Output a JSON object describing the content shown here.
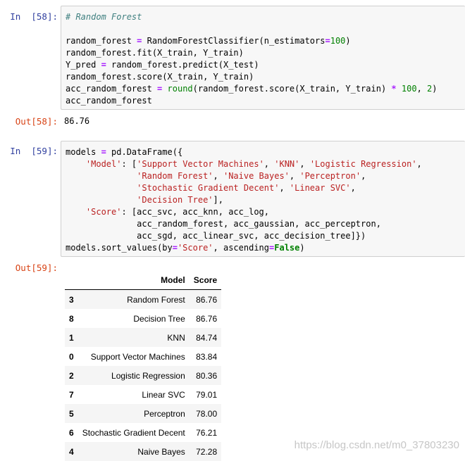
{
  "cells": [
    {
      "in_prompt": "In  [58]:",
      "code_lines": [
        "# Random Forest",
        "",
        "random_forest = RandomForestClassifier(n_estimators=100)",
        "random_forest.fit(X_train, Y_train)",
        "Y_pred = random_forest.predict(X_test)",
        "random_forest.score(X_train, Y_train)",
        "acc_random_forest = round(random_forest.score(X_train, Y_train) * 100, 2)",
        "acc_random_forest"
      ],
      "out_prompt": "Out[58]:",
      "output": "86.76"
    },
    {
      "in_prompt": "In  [59]:",
      "code_lines": [
        "models = pd.DataFrame({",
        "    'Model': ['Support Vector Machines', 'KNN', 'Logistic Regression',",
        "              'Random Forest', 'Naive Bayes', 'Perceptron',",
        "              'Stochastic Gradient Decent', 'Linear SVC',",
        "              'Decision Tree'],",
        "    'Score': [acc_svc, acc_knn, acc_log,",
        "              acc_random_forest, acc_gaussian, acc_perceptron,",
        "              acc_sgd, acc_linear_svc, acc_decision_tree]})",
        "models.sort_values(by='Score', ascending=False)"
      ],
      "out_prompt": "Out[59]:"
    }
  ],
  "table": {
    "columns": [
      "Model",
      "Score"
    ],
    "rows": [
      {
        "index": "3",
        "model": "Random Forest",
        "score": "86.76"
      },
      {
        "index": "8",
        "model": "Decision Tree",
        "score": "86.76"
      },
      {
        "index": "1",
        "model": "KNN",
        "score": "84.74"
      },
      {
        "index": "0",
        "model": "Support Vector Machines",
        "score": "83.84"
      },
      {
        "index": "2",
        "model": "Logistic Regression",
        "score": "80.36"
      },
      {
        "index": "7",
        "model": "Linear SVC",
        "score": "79.01"
      },
      {
        "index": "5",
        "model": "Perceptron",
        "score": "78.00"
      },
      {
        "index": "6",
        "model": "Stochastic Gradient Decent",
        "score": "76.21"
      },
      {
        "index": "4",
        "model": "Naive Bayes",
        "score": "72.28"
      }
    ]
  },
  "watermark": "https://blog.csdn.net/m0_37803230"
}
